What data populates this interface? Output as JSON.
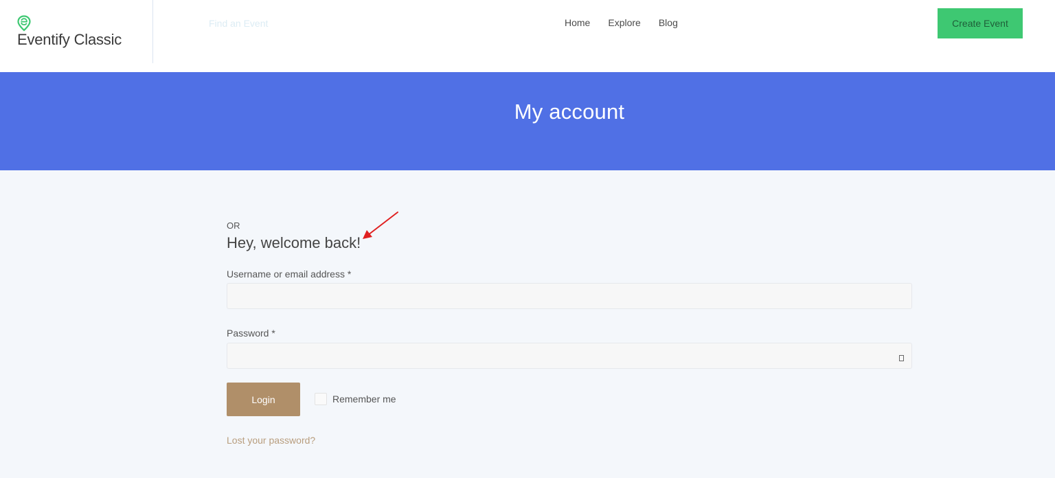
{
  "header": {
    "brand_name": "Eventify Classic",
    "find_event_label": "Find an Event",
    "nav": {
      "home": "Home",
      "explore": "Explore",
      "blog": "Blog"
    },
    "create_event_label": "Create Event"
  },
  "banner": {
    "title": "My account"
  },
  "login": {
    "or_label": "OR",
    "welcome_heading": "Hey, welcome back!",
    "username_label": "Username or email address *",
    "username_value": "",
    "password_label": "Password *",
    "password_value": "",
    "login_button_label": "Login",
    "remember_me_label": "Remember me",
    "remember_me_checked": false,
    "lost_password_label": "Lost your password?"
  },
  "icons": {
    "brand_logo": "location-pin-e-icon",
    "password_reveal": "eye-icon",
    "annotation": "red-arrow-icon"
  },
  "colors": {
    "brand_green": "#3ec872",
    "banner_blue": "#5070e5",
    "login_button": "#b08f69",
    "lost_password_link": "#b89d7d",
    "annotation_arrow": "#e02020",
    "page_background": "#f4f7fb"
  }
}
